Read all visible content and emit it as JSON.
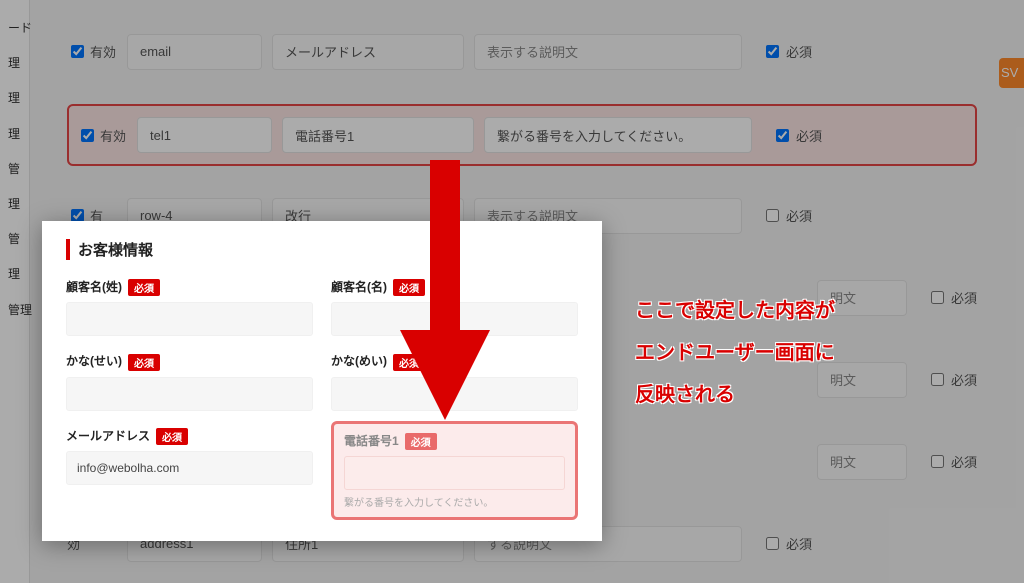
{
  "sidebar": {
    "items": [
      "ード",
      "理",
      "理",
      "理",
      "管",
      "理",
      "管",
      "理",
      "管理"
    ]
  },
  "csv_label": "SV",
  "config_rows": [
    {
      "enabled_label": "有効",
      "enabled": true,
      "key": "email",
      "name": "メールアドレス",
      "desc_placeholder": "表示する説明文",
      "desc": "",
      "required_label": "必須",
      "required": true
    },
    {
      "enabled_label": "有効",
      "enabled": true,
      "key": "tel1",
      "name": "電話番号1",
      "desc_placeholder": "",
      "desc": "繋がる番号を入力してください。",
      "required_label": "必須",
      "required": true,
      "highlight": true
    },
    {
      "enabled_label": "有",
      "enabled": true,
      "key": "row-4",
      "name": "改行",
      "desc_placeholder": "表示する説明文",
      "desc": "",
      "required_label": "必須",
      "required": false
    },
    {
      "enabled_label": "",
      "enabled": false,
      "key": "",
      "name": "",
      "desc_placeholder": "",
      "desc": "明文",
      "required_label": "必須",
      "required": false
    },
    {
      "enabled_label": "",
      "enabled": false,
      "key": "",
      "name": "",
      "desc_placeholder": "",
      "desc": "明文",
      "required_label": "必須",
      "required": false
    },
    {
      "enabled_label": "",
      "enabled": false,
      "key": "",
      "name": "",
      "desc_placeholder": "",
      "desc": "明文",
      "required_label": "必須",
      "required": false
    },
    {
      "enabled_label": "効",
      "enabled": false,
      "key": "address1",
      "name": "住所1",
      "desc_placeholder": "",
      "desc": "する説明文",
      "required_label": "必須",
      "required": false
    }
  ],
  "preview": {
    "title": "お客様情報",
    "required_badge": "必須",
    "fields": {
      "lastname": {
        "label": "顧客名(姓)",
        "value": ""
      },
      "firstname": {
        "label": "顧客名(名)",
        "value": ""
      },
      "kana_sei": {
        "label": "かな(せい)",
        "value": ""
      },
      "kana_mei": {
        "label": "かな(めい)",
        "value": ""
      },
      "email": {
        "label": "メールアドレス",
        "value": "info@webolha.com"
      },
      "tel1": {
        "label": "電話番号1",
        "value": "",
        "help": "繋がる番号を入力してください。"
      }
    }
  },
  "annotation": {
    "l1": "ここで設定した内容が",
    "l2": "エンドユーザー画面に",
    "l3": "反映される"
  }
}
